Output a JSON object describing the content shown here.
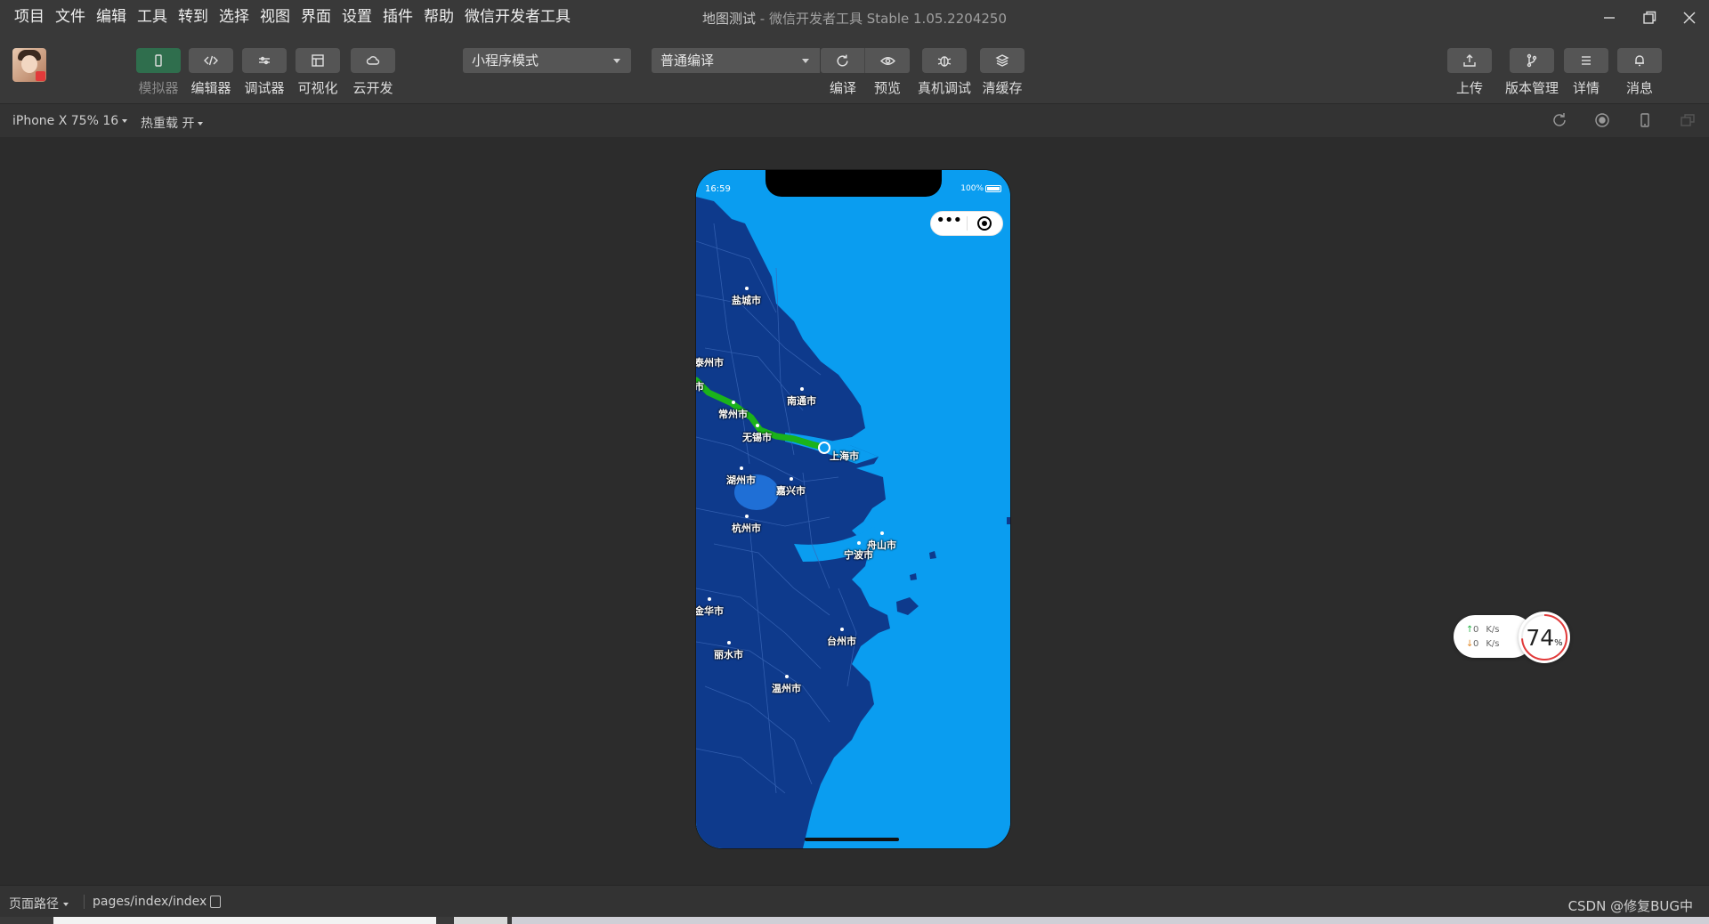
{
  "menu": [
    "项目",
    "文件",
    "编辑",
    "工具",
    "转到",
    "选择",
    "视图",
    "界面",
    "设置",
    "插件",
    "帮助",
    "微信开发者工具"
  ],
  "window": {
    "project": "地图测试",
    "separator": " - ",
    "app": "微信开发者工具 Stable 1.05.2204250"
  },
  "toolbar": {
    "simulator": "模拟器",
    "editor": "编辑器",
    "debugger": "调试器",
    "visual": "可视化",
    "cloud": "云开发",
    "mode_select": "小程序模式",
    "compile_select": "普通编译",
    "compile": "编译",
    "preview": "预览",
    "real_debug": "真机调试",
    "clear_cache": "清缓存",
    "upload": "上传",
    "version": "版本管理",
    "details": "详情",
    "messages": "消息"
  },
  "subbar": {
    "device": "iPhone X 75% 16",
    "hot_reload": "热重载 开"
  },
  "phone": {
    "time": "16:59",
    "battery": "100%",
    "capsule_dots": "•••",
    "cities": {
      "yancheng": "盐城市",
      "taizhou": "泰州市",
      "nantong": "南通市",
      "changzhou": "常州市",
      "wuxi": "无锡市",
      "shanghai": "上海市",
      "huzhou": "湖州市",
      "jiaxing": "嘉兴市",
      "hangzhou": "杭州市",
      "ningbo": "宁波市",
      "zhoushan": "舟山市",
      "jinhua": "金华市",
      "taizhou_zj": "台州市",
      "lishui": "丽水市",
      "wenzhou": "温州市",
      "partial": "市"
    }
  },
  "network": {
    "up": "0",
    "down": "0",
    "unit": "K/s",
    "percent": "74",
    "percent_sign": "%",
    "up_arrow": "↑",
    "down_arrow": "↓"
  },
  "statusbar": {
    "path_label": "页面路径",
    "path": "pages/index/index",
    "watermark": "CSDN @修复BUG中"
  },
  "colors": {
    "route": "#1bb31b",
    "sea": "#0a9df0",
    "land": "#0e3a8c",
    "active": "#2f6e4d",
    "gauge": "#e23a3a"
  }
}
